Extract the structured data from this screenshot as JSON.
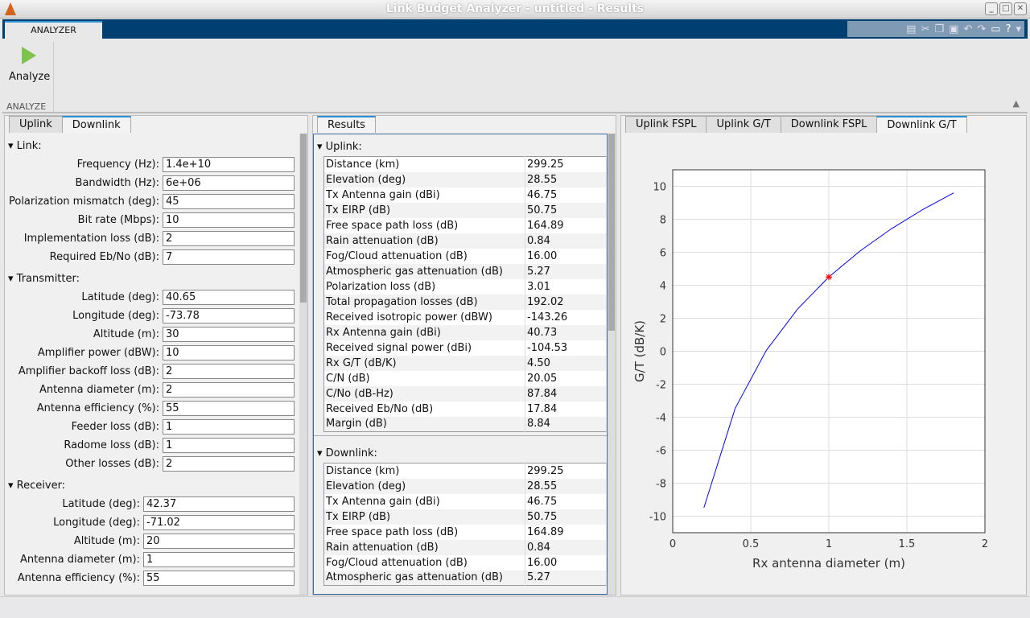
{
  "window": {
    "title": "Link Budget Analyzer - untitled - Results"
  },
  "ribbon": {
    "tab": "ANALYZER",
    "analyze_label": "Analyze",
    "group_label": "ANALYZE"
  },
  "left": {
    "tabs": [
      "Uplink",
      "Downlink"
    ],
    "active_tab": "Downlink",
    "sections": [
      {
        "title": "Link:",
        "fields": [
          {
            "label": "Frequency (Hz):",
            "value": "1.4e+10"
          },
          {
            "label": "Bandwidth (Hz):",
            "value": "6e+06"
          },
          {
            "label": "Polarization mismatch (deg):",
            "value": "45"
          },
          {
            "label": "Bit rate (Mbps):",
            "value": "10"
          },
          {
            "label": "Implementation loss (dB):",
            "value": "2"
          },
          {
            "label": "Required Eb/No (dB):",
            "value": "7"
          }
        ]
      },
      {
        "title": "Transmitter:",
        "fields": [
          {
            "label": "Latitude (deg):",
            "value": "40.65"
          },
          {
            "label": "Longitude (deg):",
            "value": "-73.78"
          },
          {
            "label": "Altitude (m):",
            "value": "30"
          },
          {
            "label": "Amplifier power (dBW):",
            "value": "10"
          },
          {
            "label": "Amplifier backoff loss (dB):",
            "value": "2"
          },
          {
            "label": "Antenna diameter (m):",
            "value": "2"
          },
          {
            "label": "Antenna efficiency (%):",
            "value": "55"
          },
          {
            "label": "Feeder loss (dB):",
            "value": "1"
          },
          {
            "label": "Radome loss (dB):",
            "value": "1"
          },
          {
            "label": "Other losses (dB):",
            "value": "2"
          }
        ]
      },
      {
        "title": "Receiver:",
        "fields": [
          {
            "label": "Latitude (deg):",
            "value": "42.37"
          },
          {
            "label": "Longitude (deg):",
            "value": "-71.02"
          },
          {
            "label": "Altitude (m):",
            "value": "20"
          },
          {
            "label": "Antenna diameter (m):",
            "value": "1"
          },
          {
            "label": "Antenna efficiency (%):",
            "value": "55"
          }
        ]
      }
    ]
  },
  "results": {
    "tab": "Results",
    "uplink": {
      "title": "Uplink:",
      "rows": [
        [
          "Distance (km)",
          "299.25"
        ],
        [
          "Elevation (deg)",
          "28.55"
        ],
        [
          "Tx Antenna gain (dBi)",
          "46.75"
        ],
        [
          "Tx EIRP (dB)",
          "50.75"
        ],
        [
          "Free space path loss (dB)",
          "164.89"
        ],
        [
          "Rain attenuation (dB)",
          "0.84"
        ],
        [
          "Fog/Cloud attenuation (dB)",
          "16.00"
        ],
        [
          "Atmospheric gas attenuation (dB)",
          "5.27"
        ],
        [
          "Polarization loss (dB)",
          "3.01"
        ],
        [
          "Total propagation losses (dB)",
          "192.02"
        ],
        [
          "Received isotropic power (dBW)",
          "-143.26"
        ],
        [
          "Rx Antenna gain (dBi)",
          "40.73"
        ],
        [
          "Received signal power (dBi)",
          "-104.53"
        ],
        [
          "Rx G/T (dB/K)",
          "4.50"
        ],
        [
          "C/N (dB)",
          "20.05"
        ],
        [
          "C/No (dB-Hz)",
          "87.84"
        ],
        [
          "Received Eb/No (dB)",
          "17.84"
        ],
        [
          "Margin (dB)",
          "8.84"
        ]
      ]
    },
    "downlink": {
      "title": "Downlink:",
      "rows": [
        [
          "Distance (km)",
          "299.25"
        ],
        [
          "Elevation (deg)",
          "28.55"
        ],
        [
          "Tx Antenna gain (dBi)",
          "46.75"
        ],
        [
          "Tx EIRP (dB)",
          "50.75"
        ],
        [
          "Free space path loss (dB)",
          "164.89"
        ],
        [
          "Rain attenuation (dB)",
          "0.84"
        ],
        [
          "Fog/Cloud attenuation (dB)",
          "16.00"
        ],
        [
          "Atmospheric gas attenuation (dB)",
          "5.27"
        ]
      ]
    }
  },
  "plots": {
    "tabs": [
      "Uplink FSPL",
      "Uplink G/T",
      "Downlink FSPL",
      "Downlink G/T"
    ],
    "active_tab": "Downlink G/T"
  },
  "chart_data": {
    "type": "line",
    "xlabel": "Rx antenna diameter (m)",
    "ylabel": "G/T (dB/K)",
    "xlim": [
      0,
      2
    ],
    "ylim": [
      -11,
      11
    ],
    "grid": true,
    "xticks": [
      "0",
      "0.5",
      "1",
      "1.5",
      "2"
    ],
    "yticks": [
      "-10",
      "-8",
      "-6",
      "-4",
      "-2",
      "0",
      "2",
      "4",
      "6",
      "8",
      "10"
    ],
    "series": [
      {
        "color": "#0000ff",
        "x": [
          0.2,
          0.4,
          0.6,
          0.8,
          1.0,
          1.2,
          1.4,
          1.6,
          1.8
        ],
        "y": [
          -9.48,
          -3.46,
          0.06,
          2.56,
          4.5,
          6.08,
          7.42,
          8.58,
          9.6
        ]
      }
    ],
    "marker": {
      "x": 1.0,
      "y": 4.5,
      "color": "#ff0000",
      "symbol": "asterisk"
    }
  }
}
